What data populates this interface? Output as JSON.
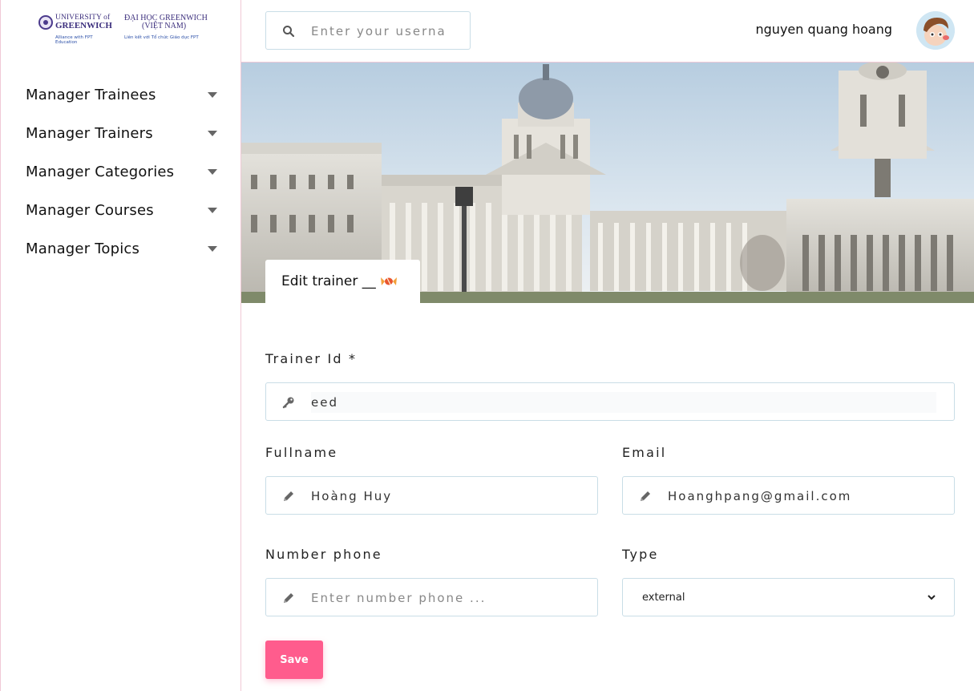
{
  "brand": {
    "logo_uog_line1": "UNIVERSITY of",
    "logo_uog_line2": "GREENWICH",
    "logo_uog_tag": "Alliance with FPT Education",
    "logo_dh_line1": "ĐẠI HỌC GREENWICH",
    "logo_dh_line2": "(VIỆT NAM)",
    "logo_dh_tag": "Liên kết với Tổ chức Giáo dục FPT"
  },
  "sidebar": {
    "items": [
      {
        "label": "Manager Trainees"
      },
      {
        "label": "Manager Trainers"
      },
      {
        "label": "Manager Categories"
      },
      {
        "label": "Manager Courses"
      },
      {
        "label": "Manager Topics"
      }
    ]
  },
  "header": {
    "search_placeholder": "Enter your userna",
    "username": "nguyen quang hoang"
  },
  "banner": {
    "tab_title": "Edit trainer __"
  },
  "form": {
    "trainer_id": {
      "label": "Trainer Id *",
      "value": "eed"
    },
    "fullname": {
      "label": "Fullname",
      "value": "Hoàng Huy"
    },
    "email": {
      "label": "Email",
      "value": "Hoanghpang@gmail.com"
    },
    "phone": {
      "label": "Number phone",
      "placeholder": "Enter number phone ..."
    },
    "type": {
      "label": "Type",
      "selected": "external"
    },
    "save_label": "Save"
  },
  "colors": {
    "accent": "#ff5c8d",
    "border": "#c9dde6",
    "divider": "#f0c9d6"
  }
}
